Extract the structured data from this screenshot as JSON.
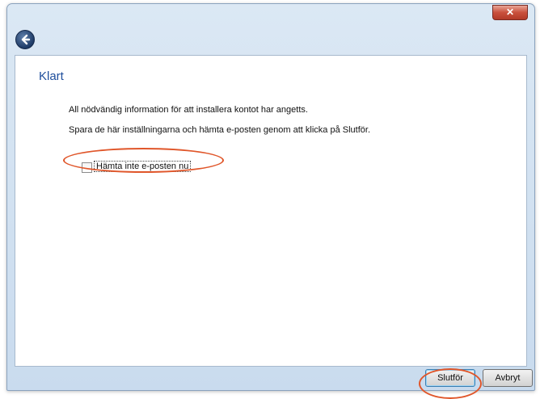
{
  "window": {
    "close_label": "✕"
  },
  "nav": {
    "back_label": "Tillbaka"
  },
  "content": {
    "heading": "Klart",
    "paragraph1": "All nödvändig information för att installera kontot har angetts.",
    "paragraph2": "Spara de här inställningarna och hämta e-posten genom att klicka på Slutför.",
    "checkbox_label": "Hämta inte e-posten nu",
    "checkbox_checked": false
  },
  "footer": {
    "finish_label": "Slutför",
    "cancel_label": "Avbryt"
  },
  "colors": {
    "heading": "#1e4e9c",
    "highlight": "#e0562a"
  }
}
